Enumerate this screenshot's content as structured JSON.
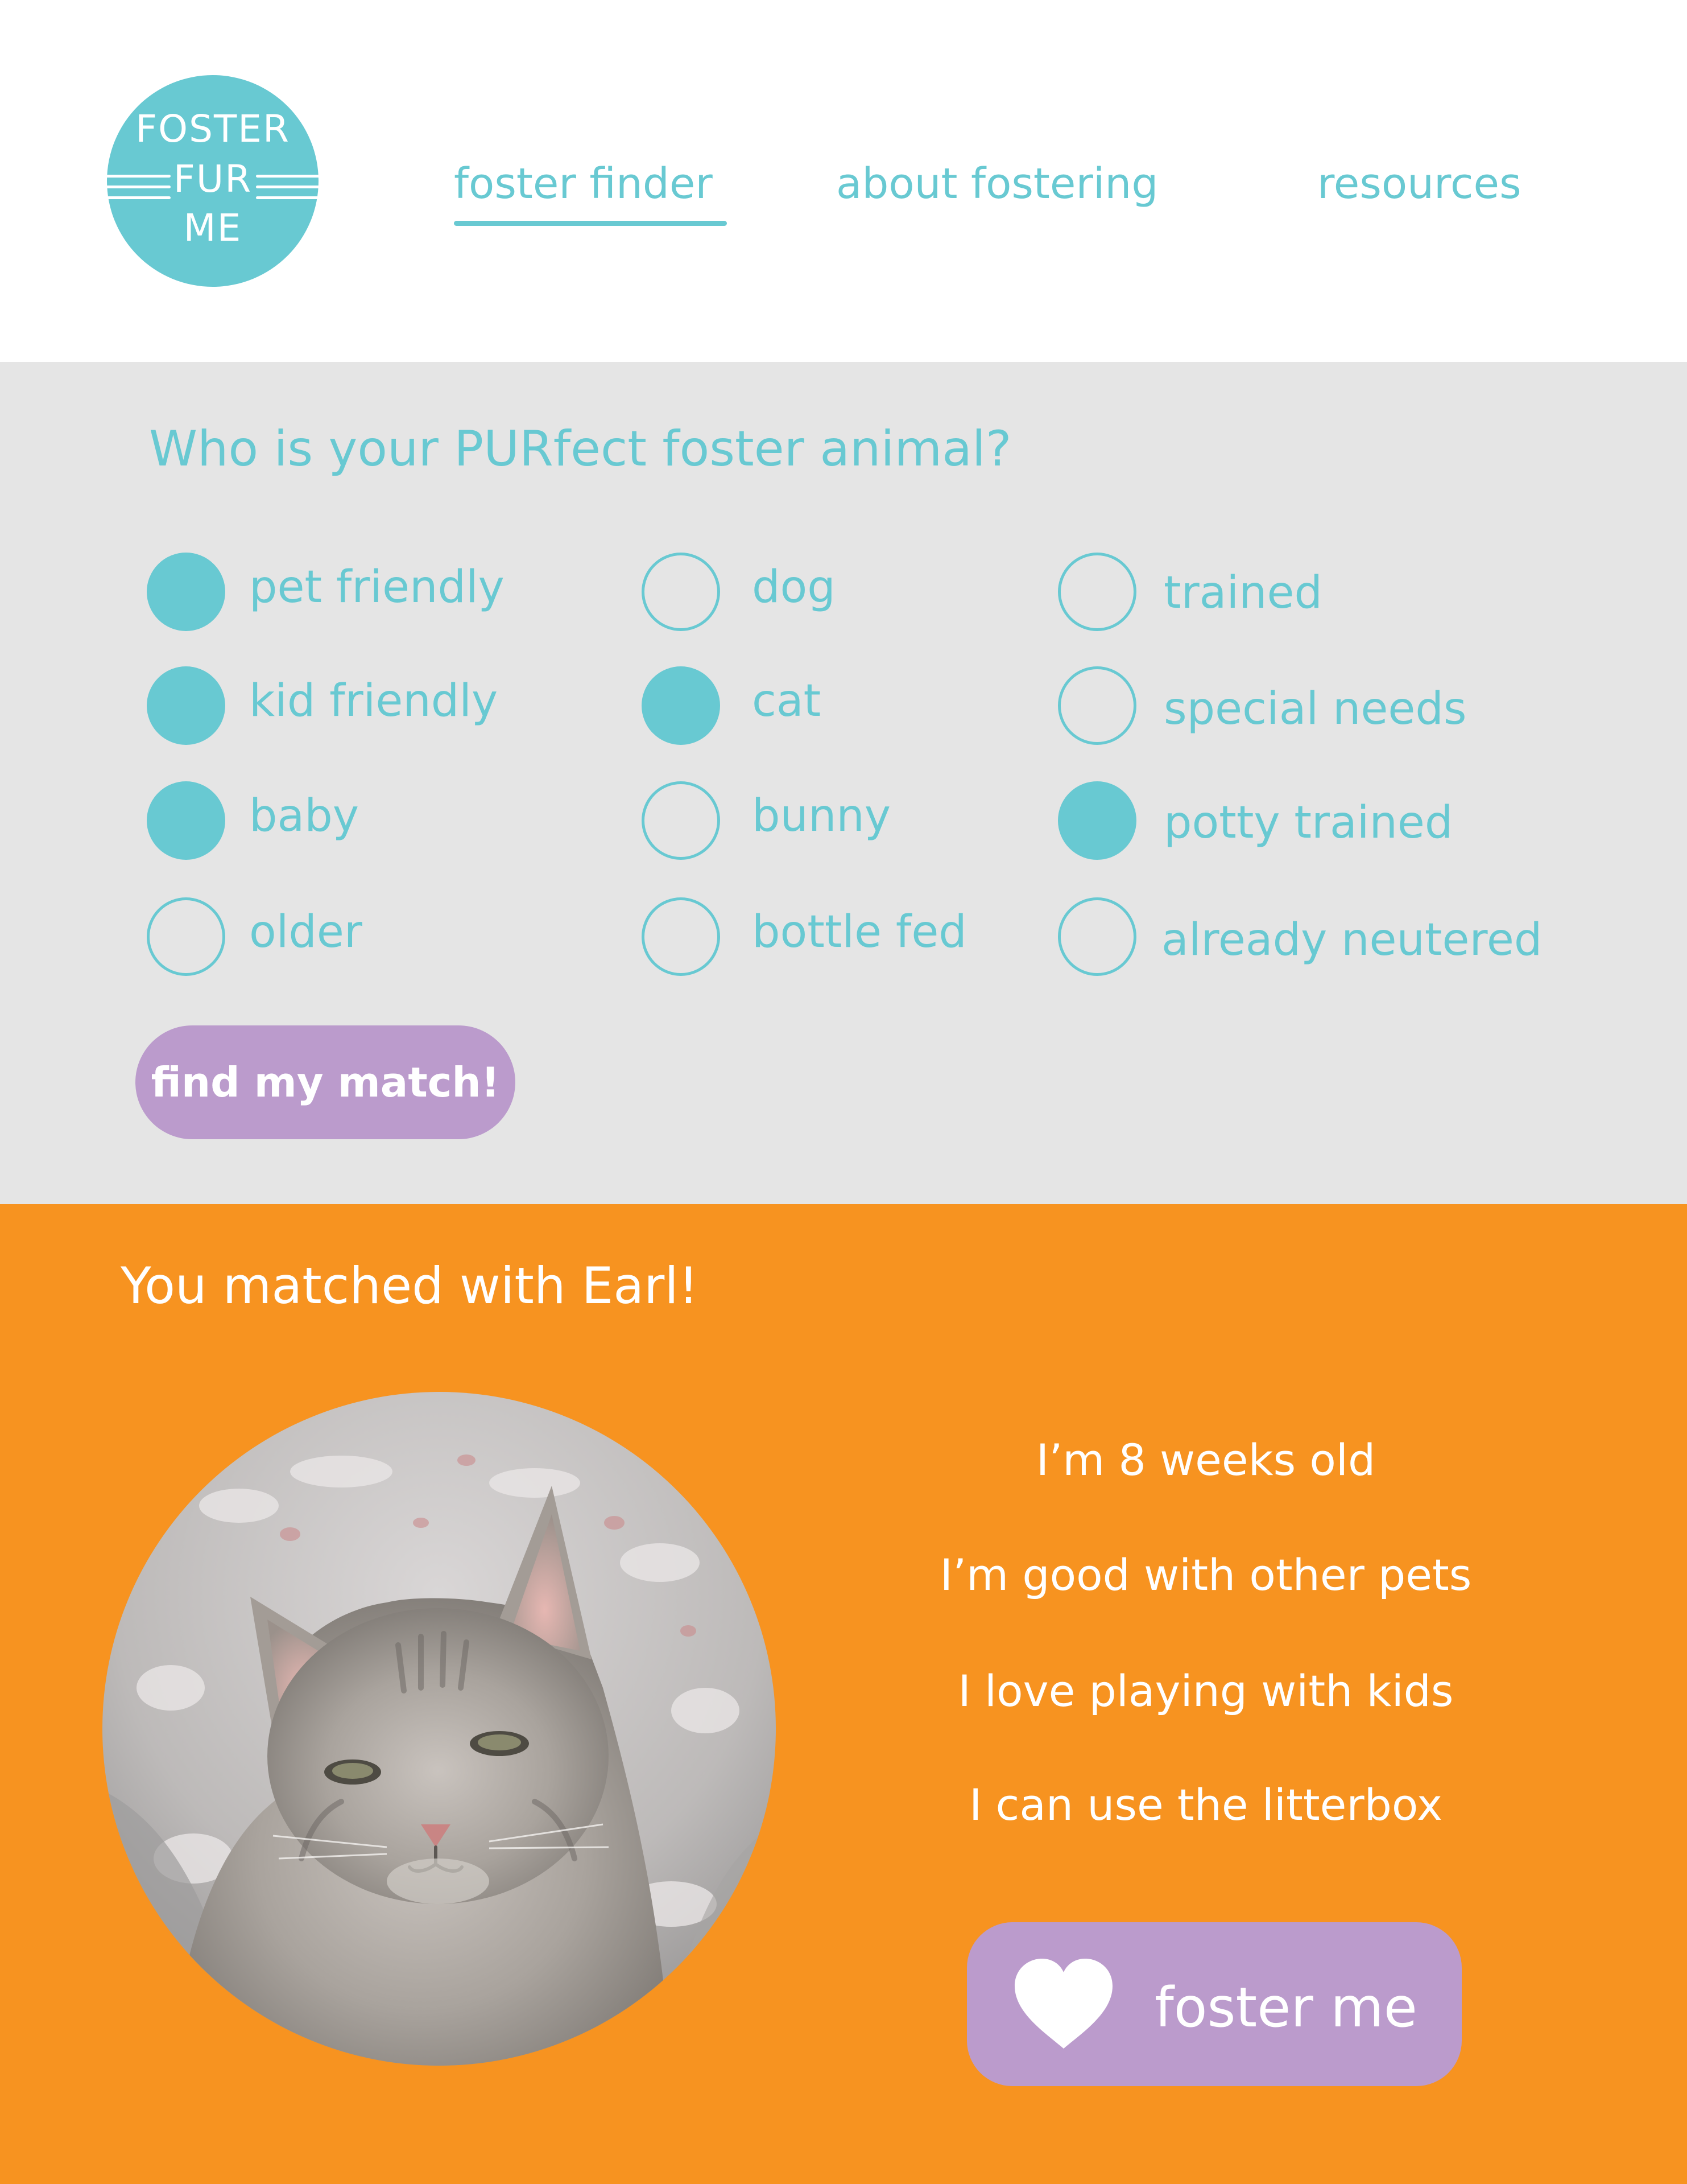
{
  "logo": {
    "line1": "FOSTER",
    "line2": "FUR",
    "line3": "ME"
  },
  "nav": {
    "items": [
      {
        "label": "foster finder",
        "active": true
      },
      {
        "label": "about fostering",
        "active": false
      },
      {
        "label": "resources",
        "active": false
      }
    ]
  },
  "filter": {
    "title": "Who is your PURfect foster animal?",
    "options": [
      {
        "label": "pet friendly",
        "checked": true
      },
      {
        "label": "kid friendly",
        "checked": true
      },
      {
        "label": "baby",
        "checked": true
      },
      {
        "label": "older",
        "checked": false
      },
      {
        "label": "dog",
        "checked": false
      },
      {
        "label": "cat",
        "checked": true
      },
      {
        "label": "bunny",
        "checked": false
      },
      {
        "label": "bottle fed",
        "checked": false
      },
      {
        "label": "trained",
        "checked": false
      },
      {
        "label": "special needs",
        "checked": false
      },
      {
        "label": "potty trained",
        "checked": true
      },
      {
        "label": "already neutered",
        "checked": false
      }
    ],
    "submit_label": "find my match!"
  },
  "result": {
    "title": "You matched with Earl!",
    "traits": [
      "I’m 8 weeks old",
      "I’m good with other pets",
      "I love playing with kids",
      "I can use the litterbox"
    ],
    "action_label": "foster me",
    "action_icon": "heart-icon"
  },
  "colors": {
    "teal": "#68c9d2",
    "purple": "#bb9bcc",
    "orange": "#f79320",
    "panel_gray": "#e5e5e5"
  }
}
